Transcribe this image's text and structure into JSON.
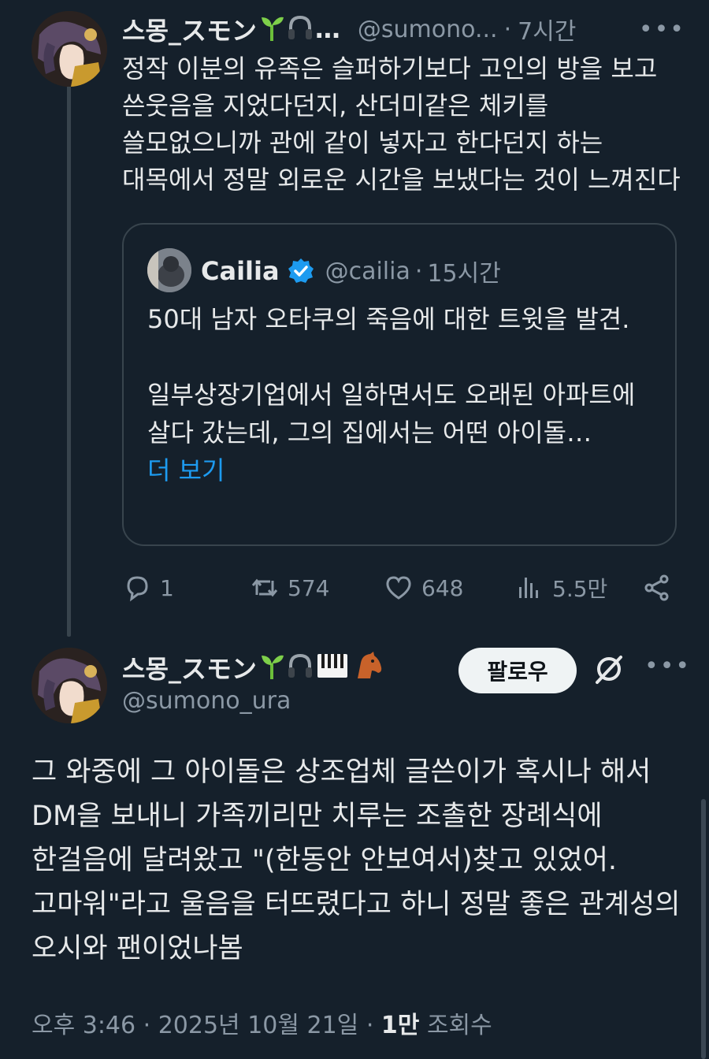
{
  "tweet1": {
    "author_name": "스몽_スモン",
    "name_emojis_truncated": "…",
    "handle": "@sumono...",
    "separator": "·",
    "time": "7시간",
    "more": "•••",
    "text": "정작 이분의 유족은 슬퍼하기보다 고인의 방을 보고 쓴웃음을 지었다던지, 산더미같은 체키를 쓸모없으니까 관에 같이 넣자고 한다던지 하는 대목에서 정말 외로운 시간을 보냈다는 것이 느껴진다"
  },
  "quote": {
    "author_name": "Cailia",
    "handle": "@cailia",
    "separator": "·",
    "time": "15시간",
    "para1": "50대 남자 오타쿠의 죽음에 대한 트윗을 발견.",
    "para2": "일부상장기업에서 일하면서도 오래된 아파트에 살다 갔는데, 그의 집에서는 어떤 아이돌…",
    "show_more": "더 보기"
  },
  "actions": {
    "replies": "1",
    "retweets": "574",
    "likes": "648",
    "views": "5.5만"
  },
  "tweet2": {
    "author_name": "스몽_スモン",
    "handle": "@sumono_ura",
    "follow_label": "팔로우",
    "more": "•••",
    "text": "그 와중에 그 아이돌은 상조업체 글쓴이가 혹시나 해서 DM을 보내니 가족끼리만 치루는 조촐한 장례식에 한걸음에 달려왔고 \"(한동안 안보여서)찾고 있었어. 고마워\"라고 울음을 터뜨렸다고 하니 정말 좋은 관계성의 오시와 팬이었나봄",
    "timestamp": "오후 3:46 · 2025년 10월 21일",
    "meta_separator": "·",
    "view_count": "1만",
    "view_label": "조회수"
  },
  "colors": {
    "background": "#15202b",
    "text": "#e7e9ea",
    "muted": "#8b98a5",
    "link": "#1d9bf0",
    "border": "#38444d"
  }
}
